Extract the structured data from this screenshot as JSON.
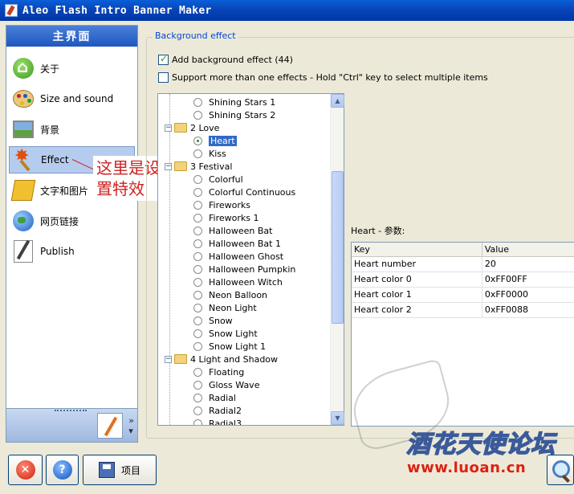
{
  "window": {
    "title": "Aleo Flash Intro Banner Maker"
  },
  "sidebar": {
    "header": "主界面",
    "items": [
      {
        "label": "关于",
        "icon": "home-icon"
      },
      {
        "label": "Size and sound",
        "icon": "palette-icon"
      },
      {
        "label": "背景",
        "icon": "picture-icon"
      },
      {
        "label": "Effect",
        "icon": "effect-icon",
        "selected": true
      },
      {
        "label": "文字和图片",
        "icon": "pencil-icon"
      },
      {
        "label": "网页链接",
        "icon": "globe-icon"
      },
      {
        "label": "Publish",
        "icon": "publish-icon"
      }
    ]
  },
  "annotation": {
    "line1": "这里是设",
    "line2": "置特效"
  },
  "effect_group": {
    "legend": "Background effect",
    "add_bg": {
      "label": "Add background effect (44)",
      "checked": true
    },
    "multi": {
      "label": "Support more than one effects - Hold \"Ctrl\" key to select multiple items",
      "checked": false
    }
  },
  "tree": [
    {
      "type": "item",
      "label": "Shining Stars 1"
    },
    {
      "type": "item",
      "label": "Shining Stars 2"
    },
    {
      "type": "group",
      "label": "2 Love"
    },
    {
      "type": "item",
      "label": "Heart",
      "selected": true
    },
    {
      "type": "item",
      "label": "Kiss"
    },
    {
      "type": "group",
      "label": "3 Festival"
    },
    {
      "type": "item",
      "label": "Colorful"
    },
    {
      "type": "item",
      "label": "Colorful Continuous"
    },
    {
      "type": "item",
      "label": "Fireworks"
    },
    {
      "type": "item",
      "label": "Fireworks 1"
    },
    {
      "type": "item",
      "label": "Halloween Bat"
    },
    {
      "type": "item",
      "label": "Halloween Bat 1"
    },
    {
      "type": "item",
      "label": "Halloween Ghost"
    },
    {
      "type": "item",
      "label": "Halloween Pumpkin"
    },
    {
      "type": "item",
      "label": "Halloween Witch"
    },
    {
      "type": "item",
      "label": "Neon Balloon"
    },
    {
      "type": "item",
      "label": "Neon Light"
    },
    {
      "type": "item",
      "label": "Snow"
    },
    {
      "type": "item",
      "label": "Snow Light"
    },
    {
      "type": "item",
      "label": "Snow Light 1"
    },
    {
      "type": "group",
      "label": "4 Light and Shadow"
    },
    {
      "type": "item",
      "label": "Floating"
    },
    {
      "type": "item",
      "label": "Gloss Wave"
    },
    {
      "type": "item",
      "label": "Radial"
    },
    {
      "type": "item",
      "label": "Radial2"
    },
    {
      "type": "item",
      "label": "Radial3"
    }
  ],
  "params": {
    "title": "Heart - 参数:",
    "headers": [
      "Key",
      "Value"
    ],
    "rows": [
      [
        "Heart number",
        "20"
      ],
      [
        "Heart color 0",
        "0xFF00FF"
      ],
      [
        "Heart color 1",
        "0xFF0000"
      ],
      [
        "Heart color 2",
        "0xFF0088"
      ]
    ]
  },
  "toolbar": {
    "project_label": "项目"
  },
  "watermark": {
    "title": "酒花天使论坛",
    "url": "www.luoan.cn"
  },
  "colors": {
    "title_bar": "#0845B8",
    "selection": "#316AC5",
    "accent_link": "#0046D5",
    "annotation": "#D02020"
  }
}
